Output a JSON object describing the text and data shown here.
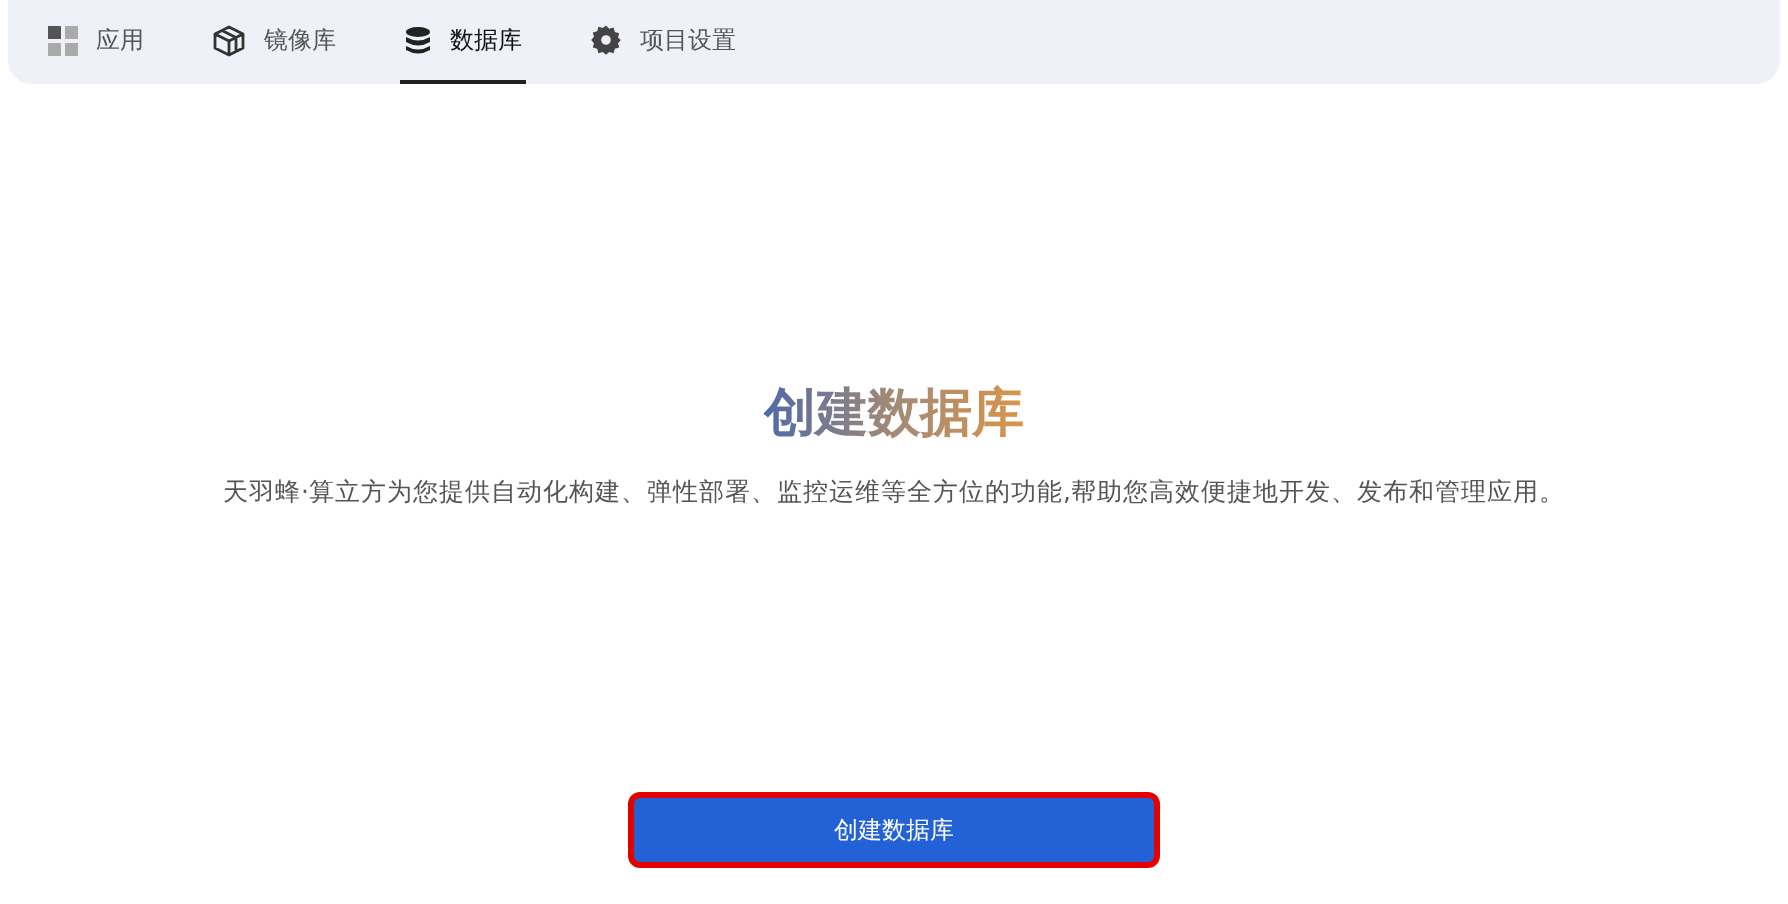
{
  "tabs": [
    {
      "label": "应用",
      "kind": "apps",
      "selected": false
    },
    {
      "label": "镜像库",
      "kind": "images",
      "selected": false
    },
    {
      "label": "数据库",
      "kind": "databases",
      "selected": true
    },
    {
      "label": "项目设置",
      "kind": "settings",
      "selected": false
    }
  ],
  "title": "创建数据库",
  "description": "天羽蜂·算立方为您提供自动化构建、弹性部署、监控运维等全方位的功能,帮助您高效便捷地开发、发布和管理应用。",
  "button": {
    "label": "创建数据库",
    "highlighted": true
  }
}
